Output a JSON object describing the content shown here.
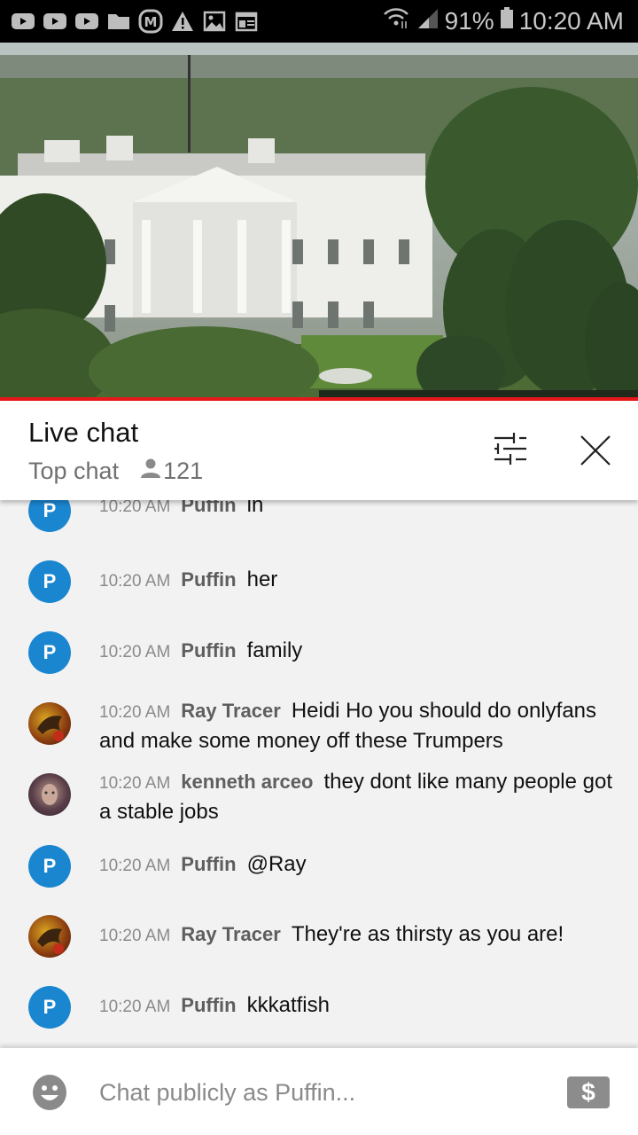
{
  "status_bar": {
    "notification_icons": [
      "youtube-icon",
      "youtube-icon",
      "youtube-icon",
      "folder-icon",
      "m-app-icon",
      "warning-icon",
      "image-icon",
      "news-icon"
    ],
    "battery": "91%",
    "time": "10:20 AM"
  },
  "video": {
    "description": "Live camera view of the White House"
  },
  "chat_header": {
    "title": "Live chat",
    "mode": "Top chat",
    "viewer_count": "121"
  },
  "messages": [
    {
      "avatar_letter": "P",
      "avatar_type": "letter",
      "time": "10:20 AM",
      "author": "Puffin",
      "text": "in"
    },
    {
      "avatar_letter": "P",
      "avatar_type": "letter",
      "time": "10:20 AM",
      "author": "Puffin",
      "text": "her"
    },
    {
      "avatar_letter": "P",
      "avatar_type": "letter",
      "time": "10:20 AM",
      "author": "Puffin",
      "text": "family"
    },
    {
      "avatar_letter": "",
      "avatar_type": "image-fire",
      "time": "10:20 AM",
      "author": "Ray Tracer",
      "text": "Heidi Ho you should do onlyfans and make some money off these Trumpers"
    },
    {
      "avatar_letter": "",
      "avatar_type": "image-face",
      "time": "10:20 AM",
      "author": "kenneth arceo",
      "text": "they dont like many people got a stable jobs"
    },
    {
      "avatar_letter": "P",
      "avatar_type": "letter",
      "time": "10:20 AM",
      "author": "Puffin",
      "text": "@Ray"
    },
    {
      "avatar_letter": "",
      "avatar_type": "image-fire",
      "time": "10:20 AM",
      "author": "Ray Tracer",
      "text": "They're as thirsty as you are!"
    },
    {
      "avatar_letter": "P",
      "avatar_type": "letter",
      "time": "10:20 AM",
      "author": "Puffin",
      "text": "kkkatfish"
    }
  ],
  "footer": {
    "placeholder": "Chat publicly as Puffin...",
    "superchat_symbol": "$"
  },
  "colors": {
    "accent_red": "#e8181a",
    "avatar_blue": "#1a86d0"
  }
}
